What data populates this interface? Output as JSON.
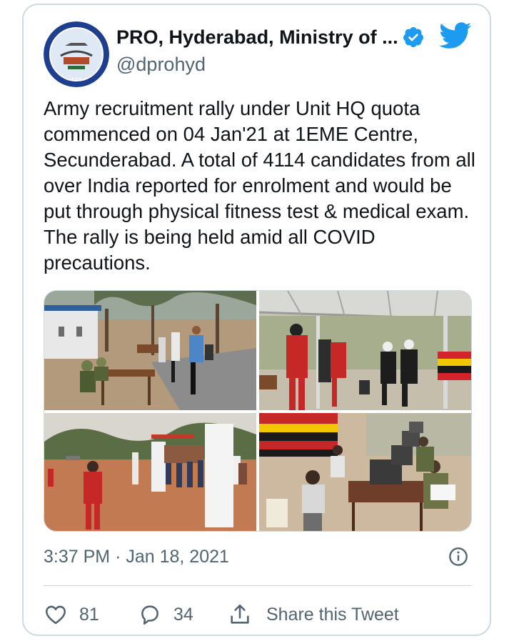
{
  "tweet": {
    "author_name": "PRO, Hyderabad, Ministry of ...",
    "handle": "@dprohyd",
    "text": "Army recruitment rally under Unit HQ quota commenced on 04 Jan'21 at 1EME Centre, Secunderabad. A total of 4114 candidates from all over India reported for enrolment and would be put through physical fitness test & medical exam. The rally is being held amid all COVID precautions.",
    "time": "3:37 PM",
    "separator": "·",
    "date": "Jan 18, 2021",
    "likes": "81",
    "replies": "34",
    "share_label": "Share this Tweet"
  },
  "icons": {
    "verified": "verified-badge-icon",
    "brand": "twitter-bird-icon",
    "info": "info-icon",
    "like": "heart-icon",
    "reply": "reply-bubble-icon",
    "share": "share-icon"
  },
  "colors": {
    "twitter_blue": "#1d9bf0",
    "secondary_text": "#536471",
    "border": "#cfd9de"
  }
}
